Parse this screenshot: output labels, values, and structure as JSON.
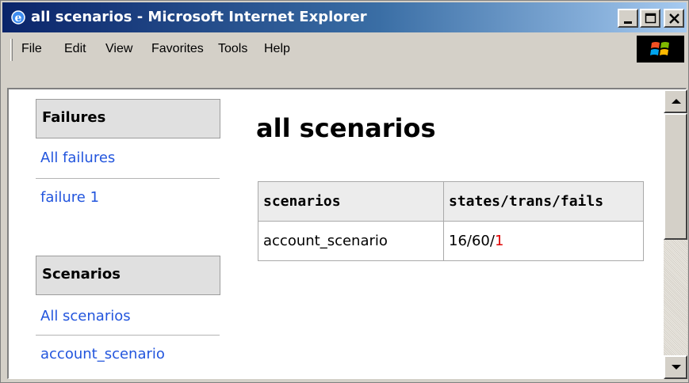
{
  "window": {
    "title": "all scenarios - Microsoft Internet Explorer",
    "title_gradient": [
      "#0a246a",
      "#a6caf0"
    ]
  },
  "menu": {
    "items": [
      "File",
      "Edit",
      "View",
      "Favorites",
      "Tools",
      "Help"
    ]
  },
  "sidebar": {
    "sections": [
      {
        "heading": "Failures",
        "links": [
          "All failures",
          "failure 1"
        ]
      },
      {
        "heading": "Scenarios",
        "links": [
          "All scenarios",
          "account_scenario"
        ]
      }
    ],
    "link_color": "#2255dd"
  },
  "main": {
    "title": "all scenarios",
    "table": {
      "headers": [
        "scenarios",
        "states/trans/fails"
      ],
      "rows": [
        {
          "scenario": "account_scenario",
          "states_trans": "16/60/",
          "fails": "1"
        }
      ]
    },
    "fail_color": "#e00000"
  },
  "icons": {
    "app": "ie-icon",
    "minimize": "minimize-icon",
    "maximize": "maximize-icon",
    "close": "close-icon",
    "logo": "windows-logo-icon",
    "scroll_up": "scroll-up-arrow-icon",
    "scroll_down": "scroll-down-arrow-icon"
  }
}
